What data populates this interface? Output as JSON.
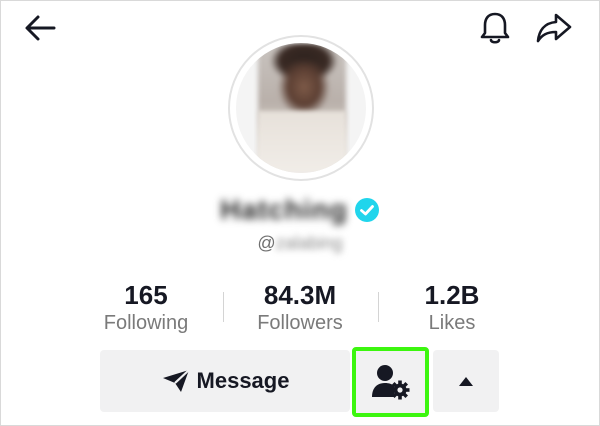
{
  "header": {
    "icons": [
      "back-arrow-icon",
      "bell-icon",
      "share-icon"
    ]
  },
  "profile": {
    "avatar_icon": "avatar",
    "display_name": "Hatching",
    "verified_icon": "verified-badge-icon",
    "handle_prefix": "@",
    "handle_rest": "zalabing"
  },
  "stats": [
    {
      "value": "165",
      "label": "Following"
    },
    {
      "value": "84.3M",
      "label": "Followers"
    },
    {
      "value": "1.2B",
      "label": "Likes"
    }
  ],
  "actions": {
    "message_label": "Message",
    "message_icon": "send-icon",
    "settings_icon": "user-gear-icon",
    "expand_icon": "caret-up-icon",
    "highlight_color": "#3cf60f"
  },
  "colors": {
    "verified": "#20d5ec",
    "text_primary": "#161823",
    "text_secondary": "#7a7a7a",
    "button_bg": "#f1f1f2"
  }
}
